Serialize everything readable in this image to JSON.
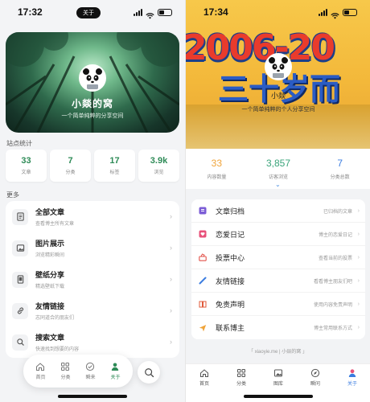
{
  "left": {
    "status": {
      "time": "17:32",
      "pill": "关于"
    },
    "hero": {
      "name": "小燚的窝",
      "tagline": "一个简单纯粹的分享空间"
    },
    "stats_title": "站点统计",
    "stats": [
      {
        "value": "33",
        "label": "文章"
      },
      {
        "value": "7",
        "label": "分类"
      },
      {
        "value": "17",
        "label": "标签"
      },
      {
        "value": "3.9k",
        "label": "浏览"
      }
    ],
    "more_title": "更多",
    "list": [
      {
        "title": "全部文章",
        "desc": "查看博主所有文章",
        "icon": "article-icon"
      },
      {
        "title": "图片展示",
        "desc": "浏览精彩瞬间",
        "icon": "image-icon"
      },
      {
        "title": "壁纸分享",
        "desc": "精选壁纸下载",
        "icon": "wallpaper-icon"
      },
      {
        "title": "友情链接",
        "desc": "志同道合的朋友们",
        "icon": "link-icon"
      },
      {
        "title": "搜索文章",
        "desc": "快速找到想要的内容",
        "icon": "search-icon"
      }
    ],
    "tabs": [
      {
        "label": "首页",
        "icon": "home-icon"
      },
      {
        "label": "分类",
        "icon": "grid-icon"
      },
      {
        "label": "瞬来",
        "icon": "check-circle-icon"
      },
      {
        "label": "关于",
        "icon": "user-icon"
      }
    ],
    "accent": "#2e8b57"
  },
  "right": {
    "status": {
      "time": "17:34"
    },
    "banner": {
      "name": "小燚",
      "tagline": "一个简单纯粹的个人分享空间"
    },
    "stats": [
      {
        "value": "33",
        "label": "内容数量",
        "color": "#f0a43a"
      },
      {
        "value": "3,857",
        "label": "访客浏览",
        "color": "#3aa47a"
      },
      {
        "value": "7",
        "label": "分类总数",
        "color": "#3b7de0"
      }
    ],
    "list": [
      {
        "label": "文章归档",
        "hint": "已归档的文章",
        "color": "#7b5cd6",
        "icon": "archive-icon"
      },
      {
        "label": "恋爱日记",
        "hint": "博主的恋爱日记",
        "color": "#e8517a",
        "icon": "heart-icon"
      },
      {
        "label": "投票中心",
        "hint": "查看当前的投票",
        "color": "#e2524a",
        "icon": "vote-icon"
      },
      {
        "label": "友情链接",
        "hint": "看看博主朋友们吧",
        "color": "#3b7de0",
        "icon": "link-icon"
      },
      {
        "label": "免责声明",
        "hint": "使用内容免责声明",
        "color": "#e05a3a",
        "icon": "book-icon"
      },
      {
        "label": "联系博主",
        "hint": "博主常用联系方式",
        "color": "#f0a43a",
        "icon": "send-icon"
      }
    ],
    "footer": "「 xiaoyie.me | 小燚的窝 」",
    "tabs": [
      {
        "label": "首页",
        "icon": "home-icon"
      },
      {
        "label": "分类",
        "icon": "grid-icon"
      },
      {
        "label": "图库",
        "icon": "image-icon"
      },
      {
        "label": "瞬问",
        "icon": "compass-icon"
      },
      {
        "label": "关于",
        "icon": "user-icon"
      }
    ],
    "accent": "#3b7de0"
  }
}
